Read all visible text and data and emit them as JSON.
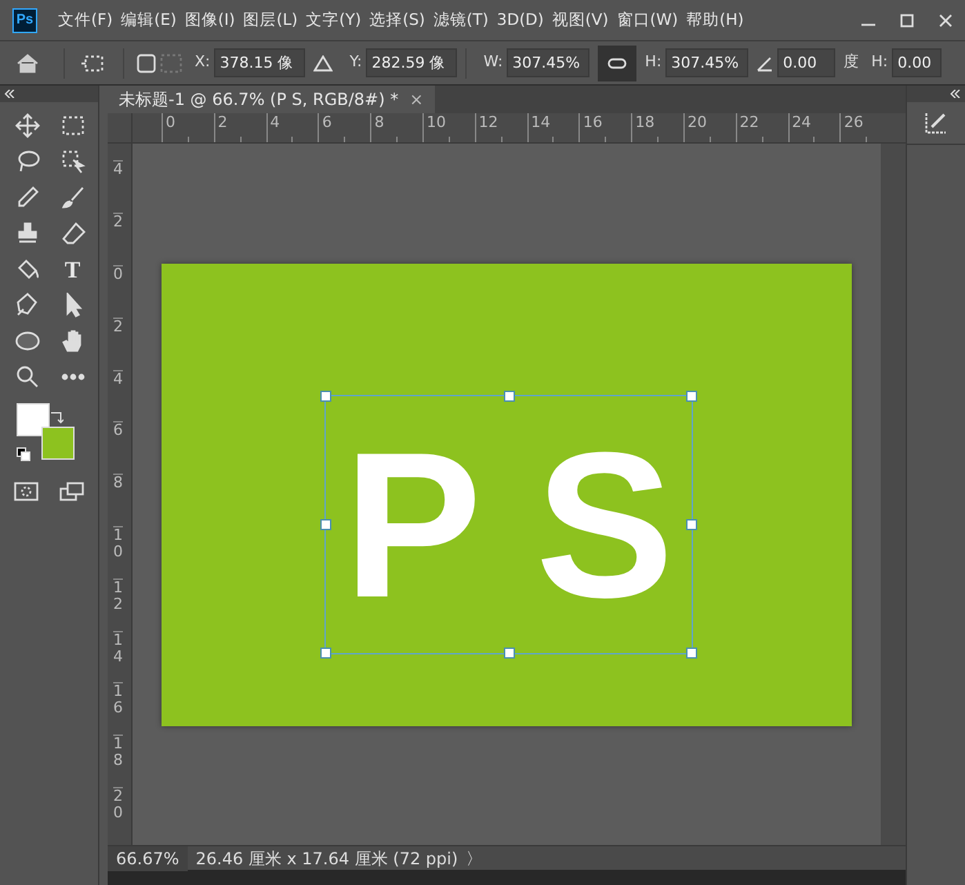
{
  "app": {
    "logo": "Ps"
  },
  "menu": [
    "文件(F)",
    "编辑(E)",
    "图像(I)",
    "图层(L)",
    "文字(Y)",
    "选择(S)",
    "滤镜(T)",
    "3D(D)",
    "视图(V)",
    "窗口(W)",
    "帮助(H)"
  ],
  "options_bar": {
    "x_label": "X:",
    "x_value": "378.15 像",
    "y_label": "Y:",
    "y_value": "282.59 像",
    "w_label": "W:",
    "w_value": "307.45%",
    "link_on": true,
    "h_label": "H:",
    "h_value": "307.45%",
    "angle_value": "0.00",
    "angle_unit": "度",
    "skew_h_label": "H:",
    "skew_h_value": "0.00"
  },
  "document_tab": {
    "title": "未标题-1 @ 66.7% (P S, RGB/8#) *",
    "close": "×",
    "selected": true
  },
  "type_tool_glyph": "T",
  "color_swatches": [
    {
      "kind": "foreground",
      "color": "#ffffff"
    },
    {
      "kind": "background",
      "color": "#8dc21f"
    }
  ],
  "rulers": {
    "horizontal": [
      "0",
      "2",
      "4",
      "6",
      "8",
      "10",
      "12",
      "14",
      "16",
      "18",
      "20",
      "22",
      "24",
      "26"
    ],
    "vertical": [
      "4",
      "2",
      "0",
      "2",
      "4",
      "6",
      "8",
      "10",
      "12",
      "14",
      "16",
      "18",
      "20"
    ]
  },
  "canvas": {
    "text": "P S",
    "transform_selected": true
  },
  "status_bar": {
    "zoom": "66.67%",
    "doc_size": "26.46 厘米 x 17.64 厘米 (72 ppi)",
    "arrow": "〉"
  }
}
